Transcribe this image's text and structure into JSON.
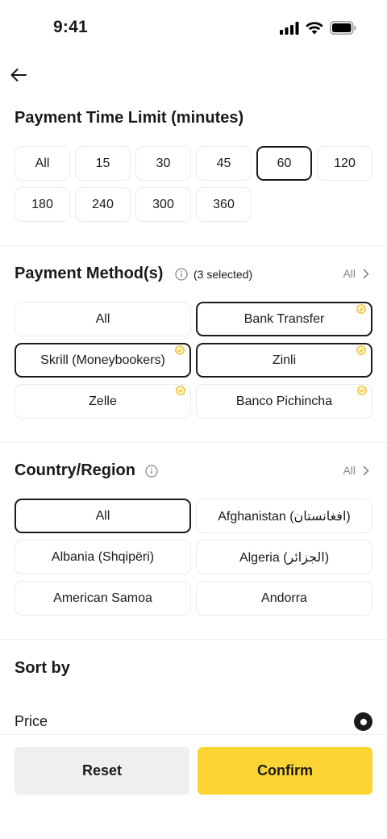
{
  "status_bar": {
    "time": "9:41"
  },
  "time_limit": {
    "title": "Payment Time Limit (minutes)",
    "options": [
      "All",
      "15",
      "30",
      "45",
      "60",
      "120",
      "180",
      "240",
      "300",
      "360"
    ],
    "selected": "60"
  },
  "payment_methods": {
    "title": "Payment Method(s)",
    "selected_count": "(3 selected)",
    "all_link": "All",
    "options": [
      "All",
      "Bank Transfer",
      "Skrill (Moneybookers)",
      "Zinli",
      "Zelle",
      "Banco Pichincha"
    ],
    "selected": [
      "Bank Transfer",
      "Skrill (Moneybookers)",
      "Zinli"
    ]
  },
  "country": {
    "title": "Country/Region",
    "all_link": "All",
    "options": [
      "All",
      "Afghanistan (افغانستان)",
      "Albania (Shqipëri)",
      "Algeria (الجزائر)",
      "American Samoa",
      "Andorra"
    ],
    "selected": "All"
  },
  "sort": {
    "title": "Sort by",
    "option_label": "Price"
  },
  "actions": {
    "reset_label": "Reset",
    "confirm_label": "Confirm"
  },
  "colors": {
    "accent": "#fcd535",
    "badge": "#f0b90b",
    "text": "#1a1a1a",
    "muted": "#8a8a8a"
  }
}
